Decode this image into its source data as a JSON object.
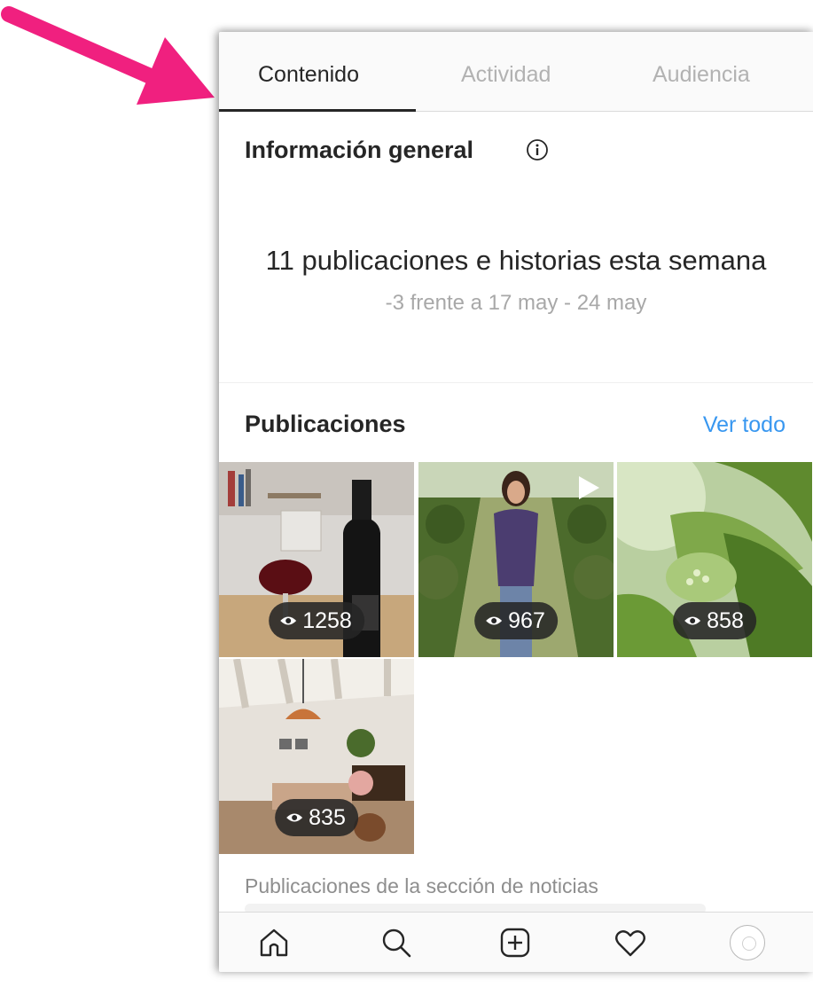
{
  "tabs": [
    {
      "label": "Contenido",
      "active": true
    },
    {
      "label": "Actividad",
      "active": false
    },
    {
      "label": "Audiencia",
      "active": false
    }
  ],
  "overview": {
    "title": "Información general",
    "summary": "11 publicaciones e historias esta semana",
    "delta": "-3 frente a 17 may - 24 may"
  },
  "posts": {
    "title": "Publicaciones",
    "see_all": "Ver todo",
    "items": [
      {
        "views": "1258",
        "subject": "wine bottle and glass",
        "is_video": false
      },
      {
        "views": "967",
        "subject": "woman in vineyard",
        "is_video": true
      },
      {
        "views": "858",
        "subject": "vine leaves and flower buds",
        "is_video": false
      },
      {
        "views": "835",
        "subject": "dining room interior",
        "is_video": false
      }
    ],
    "note": "Publicaciones de la sección de noticias"
  },
  "bottom_nav": [
    "home-icon",
    "search-icon",
    "add-post-icon",
    "heart-icon",
    "profile-avatar"
  ],
  "colors": {
    "accent_link": "#3897f0",
    "arrow": "#f0207f",
    "text": "#262626",
    "muted": "#a8a8a8"
  }
}
